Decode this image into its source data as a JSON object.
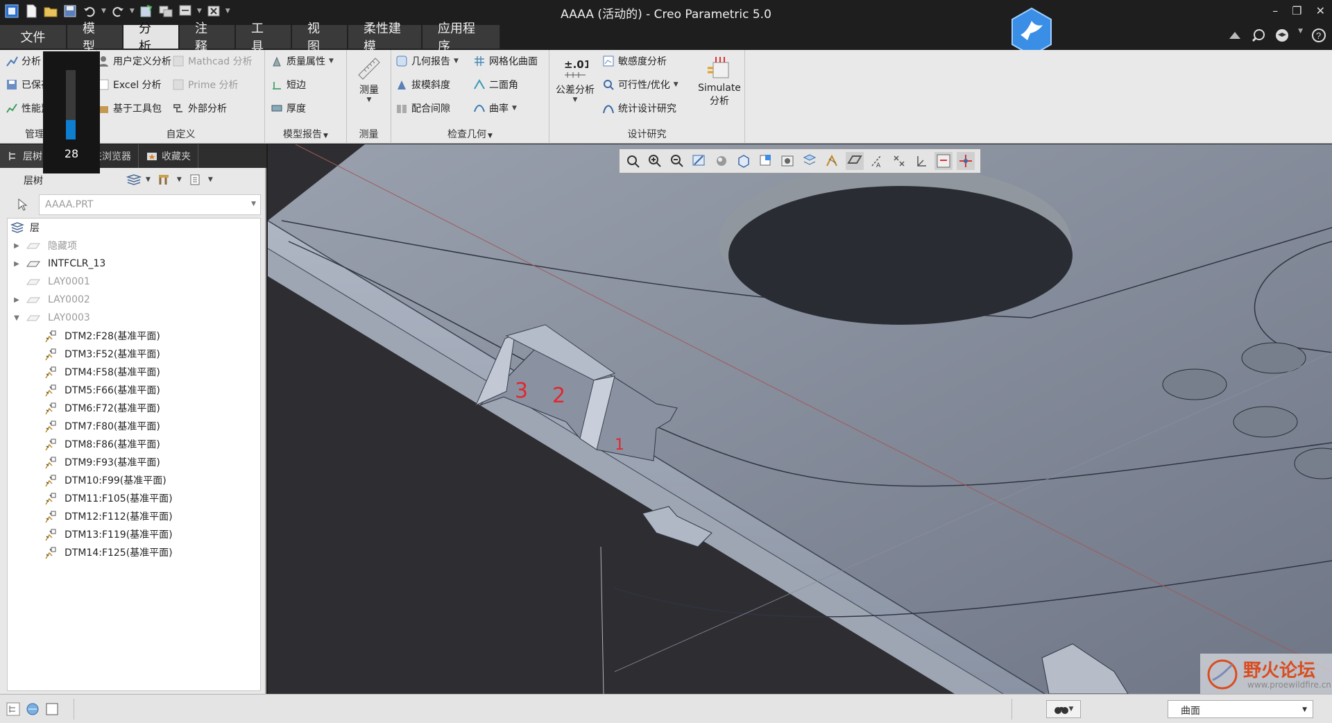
{
  "window": {
    "title": "AAAA (活动的) - Creo Parametric 5.0"
  },
  "menu_tabs": [
    {
      "label": "文件"
    },
    {
      "label": "模型"
    },
    {
      "label": "分析"
    },
    {
      "label": "注释"
    },
    {
      "label": "工具"
    },
    {
      "label": "视图"
    },
    {
      "label": "柔性建模"
    },
    {
      "label": "应用程序"
    }
  ],
  "active_tab": "分析",
  "ribbon": {
    "manage": {
      "label": "管理",
      "items": [
        "分析",
        "已保存",
        "性能监控"
      ]
    },
    "custom": {
      "label": "自定义",
      "items": [
        "用户定义分析",
        "Excel 分析",
        "基于工具包",
        "Mathcad 分析",
        "Prime 分析",
        "外部分析"
      ]
    },
    "model_report": {
      "label": "模型报告",
      "items": [
        "质量属性",
        "短边",
        "厚度"
      ]
    },
    "measure": {
      "label": "测量",
      "button": "测量"
    },
    "inspect": {
      "label": "检查几何",
      "items": [
        "几何报告",
        "拔模斜度",
        "配合间隙",
        "网格化曲面",
        "二面角",
        "曲率"
      ]
    },
    "design": {
      "label": "设计研究",
      "tolerance": "公差分析",
      "tolerance_icon_text": "±.01",
      "items": [
        "敏感度分析",
        "可行性/优化",
        "统计设计研究"
      ],
      "simulate_line1": "Simulate",
      "simulate_line2": "分析"
    }
  },
  "volume_toast": {
    "value": "28",
    "level": 0.28
  },
  "panel": {
    "tabs": [
      "层树",
      "文件夹浏览器",
      "收藏夹"
    ],
    "header": "层树",
    "model_selector": "AAAA.PRT",
    "tree": [
      {
        "label": "层",
        "level": 0,
        "expander": "",
        "dim": false,
        "type": "root"
      },
      {
        "label": "隐藏项",
        "level": 1,
        "expander": "▶",
        "dim": true,
        "type": "layer"
      },
      {
        "label": "INTFCLR_13",
        "level": 1,
        "expander": "▶",
        "dim": false,
        "type": "layer"
      },
      {
        "label": "LAY0001",
        "level": 1,
        "expander": "",
        "dim": true,
        "type": "layer"
      },
      {
        "label": "LAY0002",
        "level": 1,
        "expander": "▶",
        "dim": true,
        "type": "layer"
      },
      {
        "label": "LAY0003",
        "level": 1,
        "expander": "▼",
        "dim": true,
        "type": "layer"
      },
      {
        "label": "DTM2:F28(基准平面)",
        "level": 2,
        "expander": "",
        "dim": false,
        "type": "datum"
      },
      {
        "label": "DTM3:F52(基准平面)",
        "level": 2,
        "expander": "",
        "dim": false,
        "type": "datum"
      },
      {
        "label": "DTM4:F58(基准平面)",
        "level": 2,
        "expander": "",
        "dim": false,
        "type": "datum"
      },
      {
        "label": "DTM5:F66(基准平面)",
        "level": 2,
        "expander": "",
        "dim": false,
        "type": "datum"
      },
      {
        "label": "DTM6:F72(基准平面)",
        "level": 2,
        "expander": "",
        "dim": false,
        "type": "datum"
      },
      {
        "label": "DTM7:F80(基准平面)",
        "level": 2,
        "expander": "",
        "dim": false,
        "type": "datum"
      },
      {
        "label": "DTM8:F86(基准平面)",
        "level": 2,
        "expander": "",
        "dim": false,
        "type": "datum"
      },
      {
        "label": "DTM9:F93(基准平面)",
        "level": 2,
        "expander": "",
        "dim": false,
        "type": "datum"
      },
      {
        "label": "DTM10:F99(基准平面)",
        "level": 2,
        "expander": "",
        "dim": false,
        "type": "datum"
      },
      {
        "label": "DTM11:F105(基准平面)",
        "level": 2,
        "expander": "",
        "dim": false,
        "type": "datum"
      },
      {
        "label": "DTM12:F112(基准平面)",
        "level": 2,
        "expander": "",
        "dim": false,
        "type": "datum"
      },
      {
        "label": "DTM13:F119(基准平面)",
        "level": 2,
        "expander": "",
        "dim": false,
        "type": "datum"
      },
      {
        "label": "DTM14:F125(基准平面)",
        "level": 2,
        "expander": "",
        "dim": false,
        "type": "datum"
      }
    ]
  },
  "viewport": {
    "annotations": [
      "3",
      "2",
      "1"
    ]
  },
  "watermark": {
    "text": "野火论坛",
    "url": "www.proewildfire.cn"
  },
  "status": {
    "filter": "曲面"
  },
  "colors": {
    "accent_blue": "#0e7ed0",
    "active_tab_bg": "#e4e4e4",
    "annotation_red": "#e0282e",
    "model_surface": "#8e96a6"
  }
}
